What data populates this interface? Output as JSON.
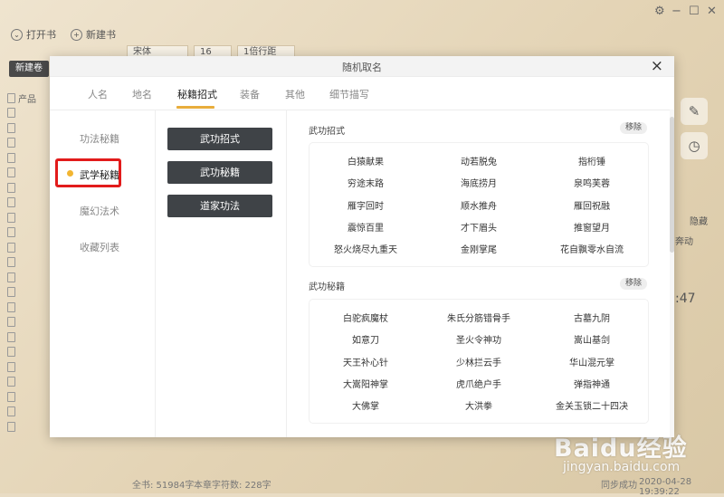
{
  "background": {
    "toolbar": {
      "open_book": "打开书",
      "new_book": "新建书"
    },
    "format": {
      "font": "宋体",
      "size": "16",
      "line": "1倍行距"
    },
    "new_volume": "新建卷",
    "book_tree_label": "产品",
    "side_fragments": {
      "hide": "隐藏",
      "text": "奔动",
      "time": ":47"
    },
    "bottom": {
      "total_words": "全书: 51984字",
      "chapter_words": "本章字符数: 228字",
      "sync": "同步成功",
      "datetime": "2020-04-28 19:39:22"
    },
    "watermark": {
      "logo": "Baidu经验",
      "url": "jingyan.baidu.com"
    }
  },
  "modal": {
    "title": "随机取名",
    "close": "×",
    "tabs": [
      "人名",
      "地名",
      "秘籍招式",
      "装备",
      "其他",
      "细节描写"
    ],
    "categories": [
      "功法秘籍",
      "武学秘籍",
      "魔幻法术",
      "收藏列表"
    ],
    "buttons": [
      "武功招式",
      "武功秘籍",
      "道家功法"
    ],
    "sections": [
      {
        "title": "武功招式",
        "remove": "移除",
        "items": [
          "白猿献果",
          "动若脱兔",
          "指桁锤",
          "穷途末路",
          "海底捞月",
          "泉鸣芙蓉",
          "雁字回时",
          "顺水推舟",
          "雁回祝融",
          "震惊百里",
          "才下眉头",
          "推窗望月",
          "怒火烧尽九重天",
          "金刚掌尾",
          "花自飘零水自流"
        ]
      },
      {
        "title": "武功秘籍",
        "remove": "移除",
        "items": [
          "白驼疯魔杖",
          "朱氏分筋错骨手",
          "古墓九阴",
          "如意刀",
          "圣火令神功",
          "嵩山基剑",
          "天王补心针",
          "少林拦云手",
          "华山混元掌",
          "大嵩阳神掌",
          "虎爪绝户手",
          "弹指神通",
          "大佛掌",
          "大洪拳",
          "金关玉锁二十四决"
        ]
      }
    ]
  }
}
